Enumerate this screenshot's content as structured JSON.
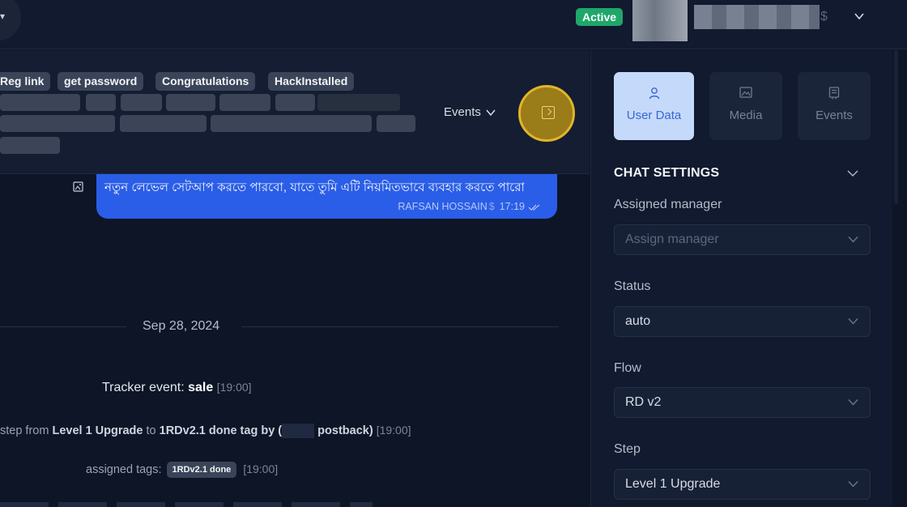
{
  "header": {
    "status_badge": "Active",
    "currency_symbol": "$"
  },
  "tags_panel": {
    "tags": [
      "Reg link",
      "get password",
      "Congratulations",
      "HackInstalled"
    ],
    "events_dropdown": "Events"
  },
  "chat": {
    "bubble_text": "নতুন লেভেল সেটআপ করতে পারবো, যাতে তুমি এটি নিয়মিতভাবে ব্যবহার করতে পারো",
    "bubble_sender": "RAFSAN HOSSAIN",
    "bubble_sender_symbol": "$",
    "bubble_time": "17:19",
    "date_separator": "Sep 28, 2024",
    "tracker_prefix": "Tracker event:",
    "tracker_event": "sale",
    "tracker_time": "[19:00]",
    "step_prefix": "step from",
    "step_from": "Level 1 Upgrade",
    "step_to_word": "to",
    "step_to": "1RDv2.1 done tag by",
    "step_open_paren": "(",
    "step_source": "postback)",
    "step_time": "[19:00]",
    "assigned_prefix": "assigned tags:",
    "assigned_tag": "1RDv2.1 done",
    "assigned_time": "[19:00]"
  },
  "right_panel": {
    "tabs": [
      {
        "label": "User Data",
        "icon": "user-icon",
        "active": true
      },
      {
        "label": "Media",
        "icon": "image-icon",
        "active": false
      },
      {
        "label": "Events",
        "icon": "events-icon",
        "active": false
      }
    ],
    "settings_title": "CHAT SETTINGS",
    "fields": {
      "manager_label": "Assigned manager",
      "manager_placeholder": "Assign manager",
      "status_label": "Status",
      "status_value": "auto",
      "flow_label": "Flow",
      "flow_value": "RD v2",
      "step_label": "Step",
      "step_value": "Level 1 Upgrade"
    }
  },
  "colors": {
    "accent_blue": "#2a5ee8",
    "active_green": "#1fa76a",
    "highlight_yellow": "#e1b52a"
  }
}
